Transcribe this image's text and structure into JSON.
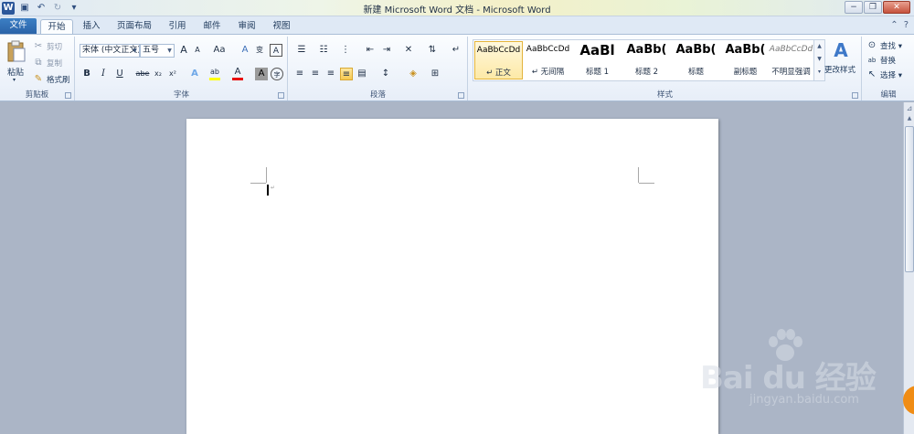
{
  "window": {
    "title": "新建 Microsoft Word 文档 - Microsoft Word",
    "controls": {
      "minimize": "−",
      "restore": "❐",
      "close": "✕"
    }
  },
  "qat": {
    "logo": "W"
  },
  "tabs": [
    {
      "label": "文件"
    },
    {
      "label": "开始"
    },
    {
      "label": "插入"
    },
    {
      "label": "页面布局"
    },
    {
      "label": "引用"
    },
    {
      "label": "邮件"
    },
    {
      "label": "审阅"
    },
    {
      "label": "视图"
    }
  ],
  "ribbon": {
    "clipboard": {
      "label": "剪贴板",
      "paste": "粘贴",
      "cut": "剪切",
      "copy": "复制",
      "format_painter": "格式刷"
    },
    "font": {
      "label": "字体",
      "font_name": "宋体 (中文正文)",
      "font_size": "五号",
      "grow": "A",
      "shrink": "A",
      "change_case": "Aa",
      "clear": "A",
      "bold": "B",
      "italic": "I",
      "underline": "U",
      "strike": "abe",
      "subscript": "x₂",
      "superscript": "x²",
      "text_effects": "A",
      "highlight": "ab",
      "font_color": "A",
      "char_shading": "A",
      "enclose": "字"
    },
    "paragraph": {
      "label": "段落"
    },
    "styles": {
      "label": "样式",
      "items": [
        {
          "sample": "AaBbCcDd",
          "name": "↵ 正文"
        },
        {
          "sample": "AaBbCcDd",
          "name": "↵ 无间隔"
        },
        {
          "sample": "AaBl",
          "name": "标题 1"
        },
        {
          "sample": "AaBb(",
          "name": "标题 2"
        },
        {
          "sample": "AaBb(",
          "name": "标题"
        },
        {
          "sample": "AaBb(",
          "name": "副标题"
        },
        {
          "sample": "AaBbCcDd",
          "name": "不明显强调"
        }
      ],
      "change_styles": "更改样式"
    },
    "editing": {
      "label": "编辑",
      "find": "查找 ▾",
      "replace": "替换",
      "select": "选择 ▾"
    }
  },
  "document": {
    "paragraph_mark": "↵"
  },
  "watermark": {
    "brand": "Bai  du 经验",
    "url": "jingyan.baidu.com"
  },
  "colors": {
    "accent": "#2b579a",
    "highlight": "#f6c94f",
    "font_color_bar": "#e81010",
    "highlight_bar": "#ffff00"
  }
}
